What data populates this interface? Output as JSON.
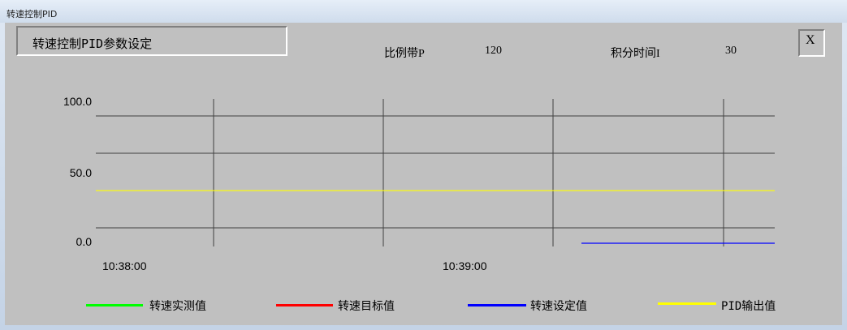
{
  "window": {
    "title": "转速控制PID"
  },
  "panel": {
    "title": "转速控制PID参数设定",
    "close_label": "X",
    "params": [
      {
        "label": "比例带P",
        "value": "120"
      },
      {
        "label": "积分时间I",
        "value": "30"
      }
    ]
  },
  "chart_data": {
    "type": "line",
    "title": "",
    "y_ticks": [
      "100.0",
      "50.0",
      "0.0"
    ],
    "ylim": [
      0,
      100
    ],
    "x_ticks": [
      "10:38:00",
      "10:39:00"
    ],
    "grid": true,
    "legend_placement": "bottom",
    "series": [
      {
        "name": "转速实测值",
        "color": "#00ff00",
        "values": []
      },
      {
        "name": "转速目标值",
        "color": "#ff0000",
        "values": []
      },
      {
        "name": "转速设定值",
        "color": "#0000ff",
        "values": [
          0,
          0
        ],
        "span": [
          "after 10:39:00",
          "end"
        ]
      },
      {
        "name": "PID输出值",
        "color": "#ffff00",
        "values": [
          36,
          36
        ],
        "span": [
          "start",
          "end"
        ]
      }
    ]
  }
}
